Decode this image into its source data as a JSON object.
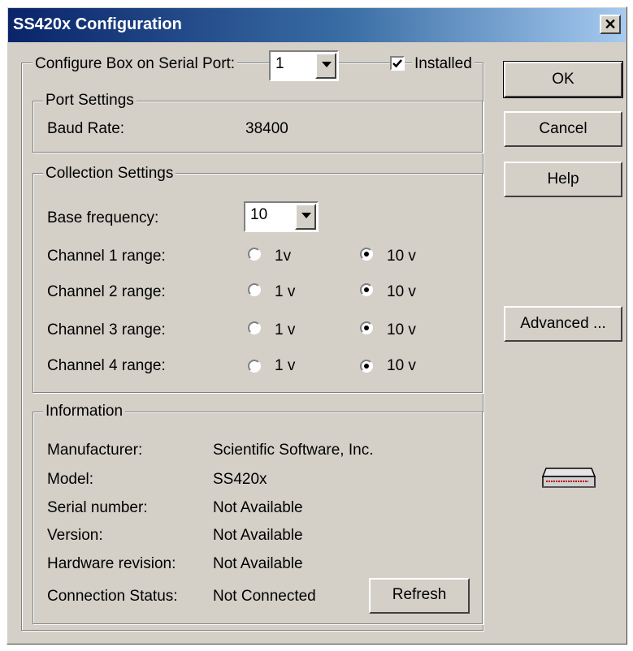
{
  "window": {
    "title": "SS420x Configuration"
  },
  "configure": {
    "label": "Configure Box on Serial Port:",
    "port_value": "1",
    "installed_label": "Installed",
    "installed_checked": true
  },
  "buttons": {
    "ok": "OK",
    "cancel": "Cancel",
    "help": "Help",
    "advanced": "Advanced ...",
    "refresh": "Refresh"
  },
  "port_settings": {
    "title": "Port Settings",
    "baud_label": "Baud Rate:",
    "baud_value": "38400"
  },
  "collection": {
    "title": "Collection Settings",
    "base_label": "Base frequency:",
    "base_value": "10",
    "channels": [
      {
        "label": "Channel 1 range:",
        "opt1": "1v",
        "opt2": "10 v",
        "selected": "10 v"
      },
      {
        "label": "Channel 2 range:",
        "opt1": "1 v",
        "opt2": "10 v",
        "selected": "10 v"
      },
      {
        "label": "Channel 3 range:",
        "opt1": "1 v",
        "opt2": "10 v",
        "selected": "10 v"
      },
      {
        "label": "Channel 4 range:",
        "opt1": "1 v",
        "opt2": "10 v",
        "selected": "10 v"
      }
    ]
  },
  "information": {
    "title": "Information",
    "rows": [
      {
        "label": "Manufacturer:",
        "value": "Scientific Software, Inc."
      },
      {
        "label": "Model:",
        "value": "SS420x"
      },
      {
        "label": "Serial number:",
        "value": "Not Available"
      },
      {
        "label": "Version:",
        "value": "Not Available"
      },
      {
        "label": "Hardware revision:",
        "value": "Not Available"
      },
      {
        "label": "Connection Status:",
        "value": "Not Connected"
      }
    ]
  },
  "icons": {
    "device": "device-box-icon",
    "close": "close-icon",
    "dropdown": "chevron-down-icon",
    "check": "checkmark-icon"
  }
}
